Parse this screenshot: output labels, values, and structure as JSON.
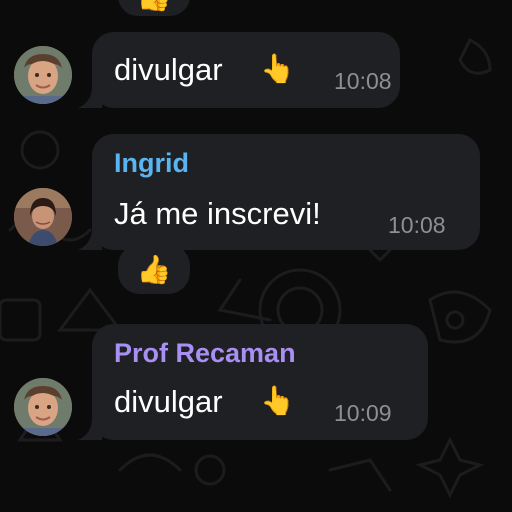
{
  "messages": [
    {
      "sender": "",
      "text": "divulgar",
      "emoji": "👆",
      "time": "10:08",
      "avatar": "prof-recaman-avatar",
      "reaction": ""
    },
    {
      "sender": "Ingrid",
      "sender_color": "#5ab4f0",
      "text": "Já me inscrevi!",
      "emoji": "",
      "time": "10:08",
      "avatar": "ingrid-avatar",
      "reaction": "👍"
    },
    {
      "sender": "Prof Recaman",
      "sender_color": "#a98ff4",
      "text": "divulgar",
      "emoji": "👆",
      "time": "10:09",
      "avatar": "prof-recaman-avatar",
      "reaction": ""
    }
  ],
  "top_reaction": "👍",
  "colors": {
    "background": "#0b0b0c",
    "bubble": "#1f2023",
    "time": "#8e8e93"
  }
}
